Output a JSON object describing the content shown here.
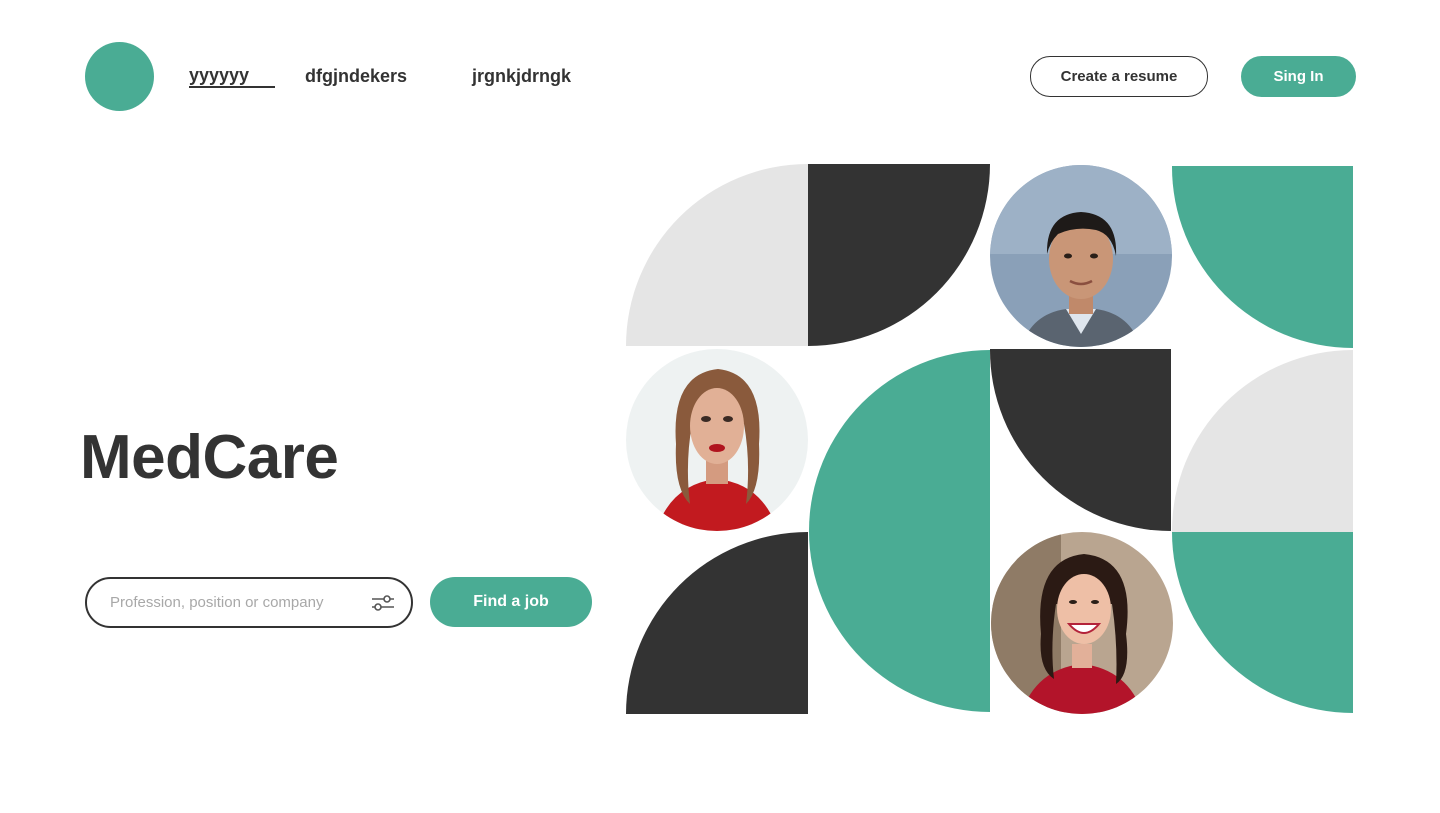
{
  "header": {
    "nav": [
      {
        "label": "yyyyyy",
        "active": true
      },
      {
        "label": "dfgjndekers",
        "active": false
      },
      {
        "label": "jrgnkjdrngk",
        "active": false
      }
    ],
    "create_resume_label": "Create a resume",
    "sign_in_label": "Sing In"
  },
  "hero": {
    "title": "MedCare",
    "search": {
      "placeholder": "Profession, position or company",
      "value": ""
    },
    "find_job_label": "Find a job"
  },
  "colors": {
    "accent": "#4aac94",
    "dark": "#333333",
    "light_gray": "#e5e5e5"
  },
  "icons": [
    "filter-sliders-icon",
    "person-photo-man",
    "person-photo-woman-red-lips",
    "person-photo-woman-smiling"
  ]
}
